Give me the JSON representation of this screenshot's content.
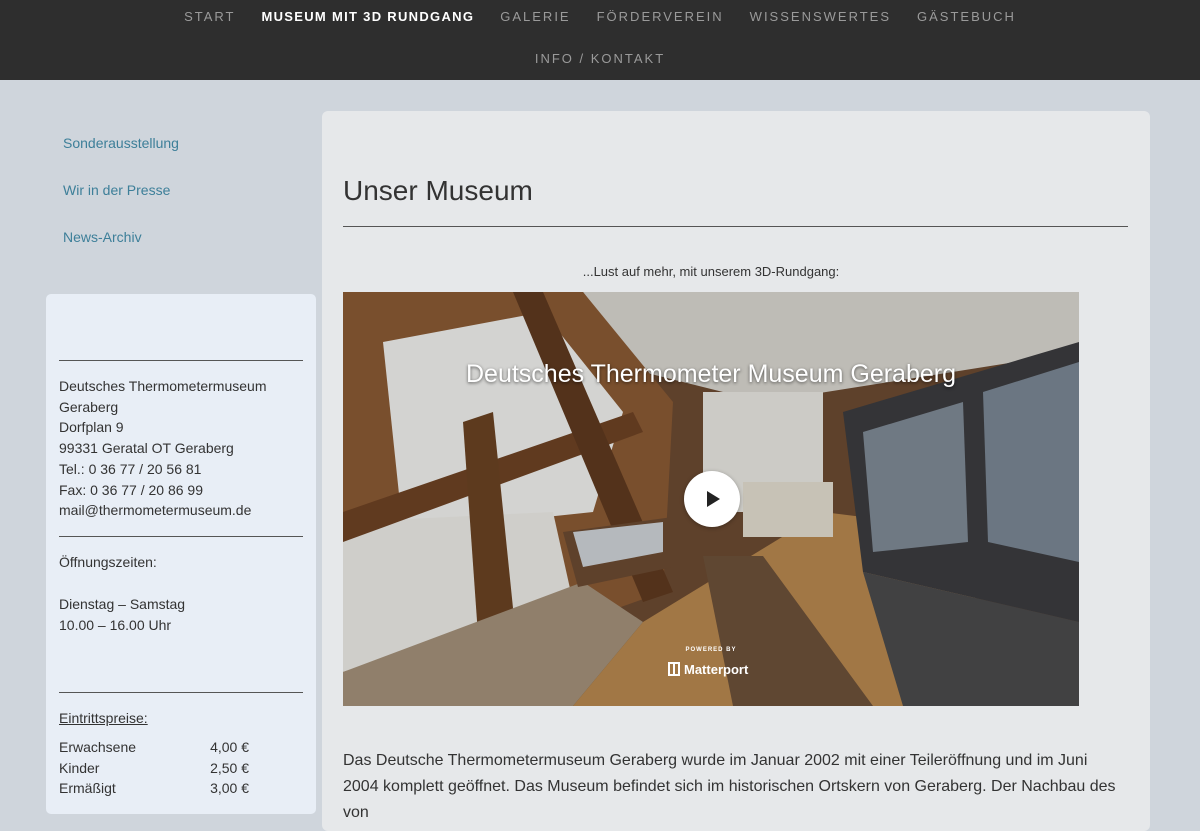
{
  "nav": {
    "row1": [
      {
        "label": "START",
        "active": false
      },
      {
        "label": "MUSEUM MIT 3D RUNDGANG",
        "active": true
      },
      {
        "label": "GALERIE",
        "active": false
      },
      {
        "label": "FÖRDERVEREIN",
        "active": false
      },
      {
        "label": "WISSENSWERTES",
        "active": false
      },
      {
        "label": "GÄSTEBUCH",
        "active": false
      }
    ],
    "row2": [
      {
        "label": "INFO / KONTAKT",
        "active": false
      }
    ]
  },
  "sidebar": {
    "links": [
      "Sonderausstellung",
      "Wir in der Presse",
      "News-Archiv"
    ]
  },
  "info": {
    "address": [
      "Deutsches Thermometermuseum",
      "Geraberg",
      "Dorfplan 9",
      "99331 Geratal OT Geraberg",
      "Tel.: 0 36 77 / 20 56 81",
      "Fax: 0 36 77 / 20 86 99",
      "mail@thermometermuseum.de"
    ],
    "hours_label": "Öffnungszeiten:",
    "hours_days": "Dienstag – Samstag",
    "hours_time": "10.00 – 16.00 Uhr",
    "prices_label": "Eintrittspreise:",
    "prices": [
      {
        "name": "Erwachsene",
        "price": "4,00 €"
      },
      {
        "name": "Kinder",
        "price": "2,50 €"
      },
      {
        "name": "Ermäßigt",
        "price": "3,00 €"
      }
    ]
  },
  "main": {
    "title": "Unser Museum",
    "intro": "...Lust auf mehr, mit unserem 3D-Rundgang:",
    "video": {
      "title": "Deutsches Thermometer Museum Geraberg",
      "powered_by": "POWERED BY",
      "brand": "Matterport"
    },
    "body": "Das Deutsche Thermometermuseum Geraberg wurde im Januar 2002 mit einer Teileröffnung und im Juni 2004 komplett geöffnet. Das Museum befindet sich im historischen Ortskern von Geraberg. Der Nachbau des von"
  },
  "colors": {
    "nav_bg": "#2e2e2e",
    "page_bg": "#cfd5dc",
    "link": "#3d7f99",
    "panel_bg": "#e6e8ea",
    "infobox_bg": "#e8eef6"
  }
}
